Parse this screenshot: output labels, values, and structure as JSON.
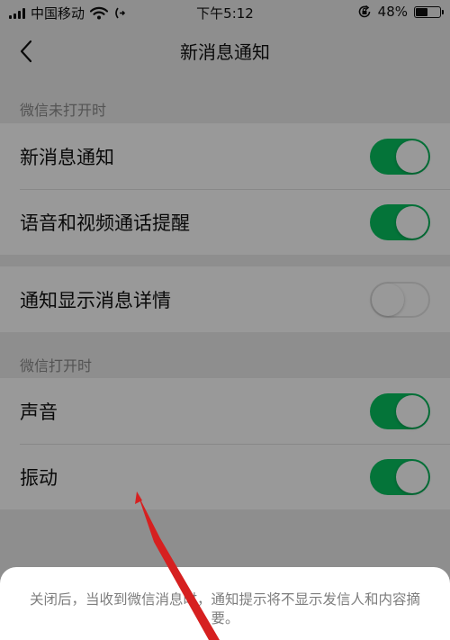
{
  "status_bar": {
    "carrier": "中国移动",
    "time": "下午5:12",
    "battery": "48%",
    "battery_level": 0.48,
    "icons": [
      "signal-icon",
      "wifi-icon",
      "call-forwarding-icon",
      "orientation-lock-icon",
      "battery-icon"
    ]
  },
  "nav": {
    "title": "新消息通知",
    "back_icon": "chevron-left-icon"
  },
  "sections": {
    "closed_title": "微信未打开时",
    "open_title": "微信打开时"
  },
  "rows": {
    "new_message": {
      "label": "新消息通知",
      "on": true
    },
    "voice_video": {
      "label": "语音和视频通话提醒",
      "on": true
    },
    "show_details": {
      "label": "通知显示消息详情",
      "on": false
    },
    "sound": {
      "label": "声音",
      "on": true
    },
    "vibrate": {
      "label": "振动",
      "on": true
    }
  },
  "sheet": {
    "text": "关闭后，当收到微信消息时，通知提示将不显示发信人和内容摘要。"
  },
  "colors": {
    "toggle_on": "#07c160",
    "annotation_arrow": "#d62020"
  }
}
